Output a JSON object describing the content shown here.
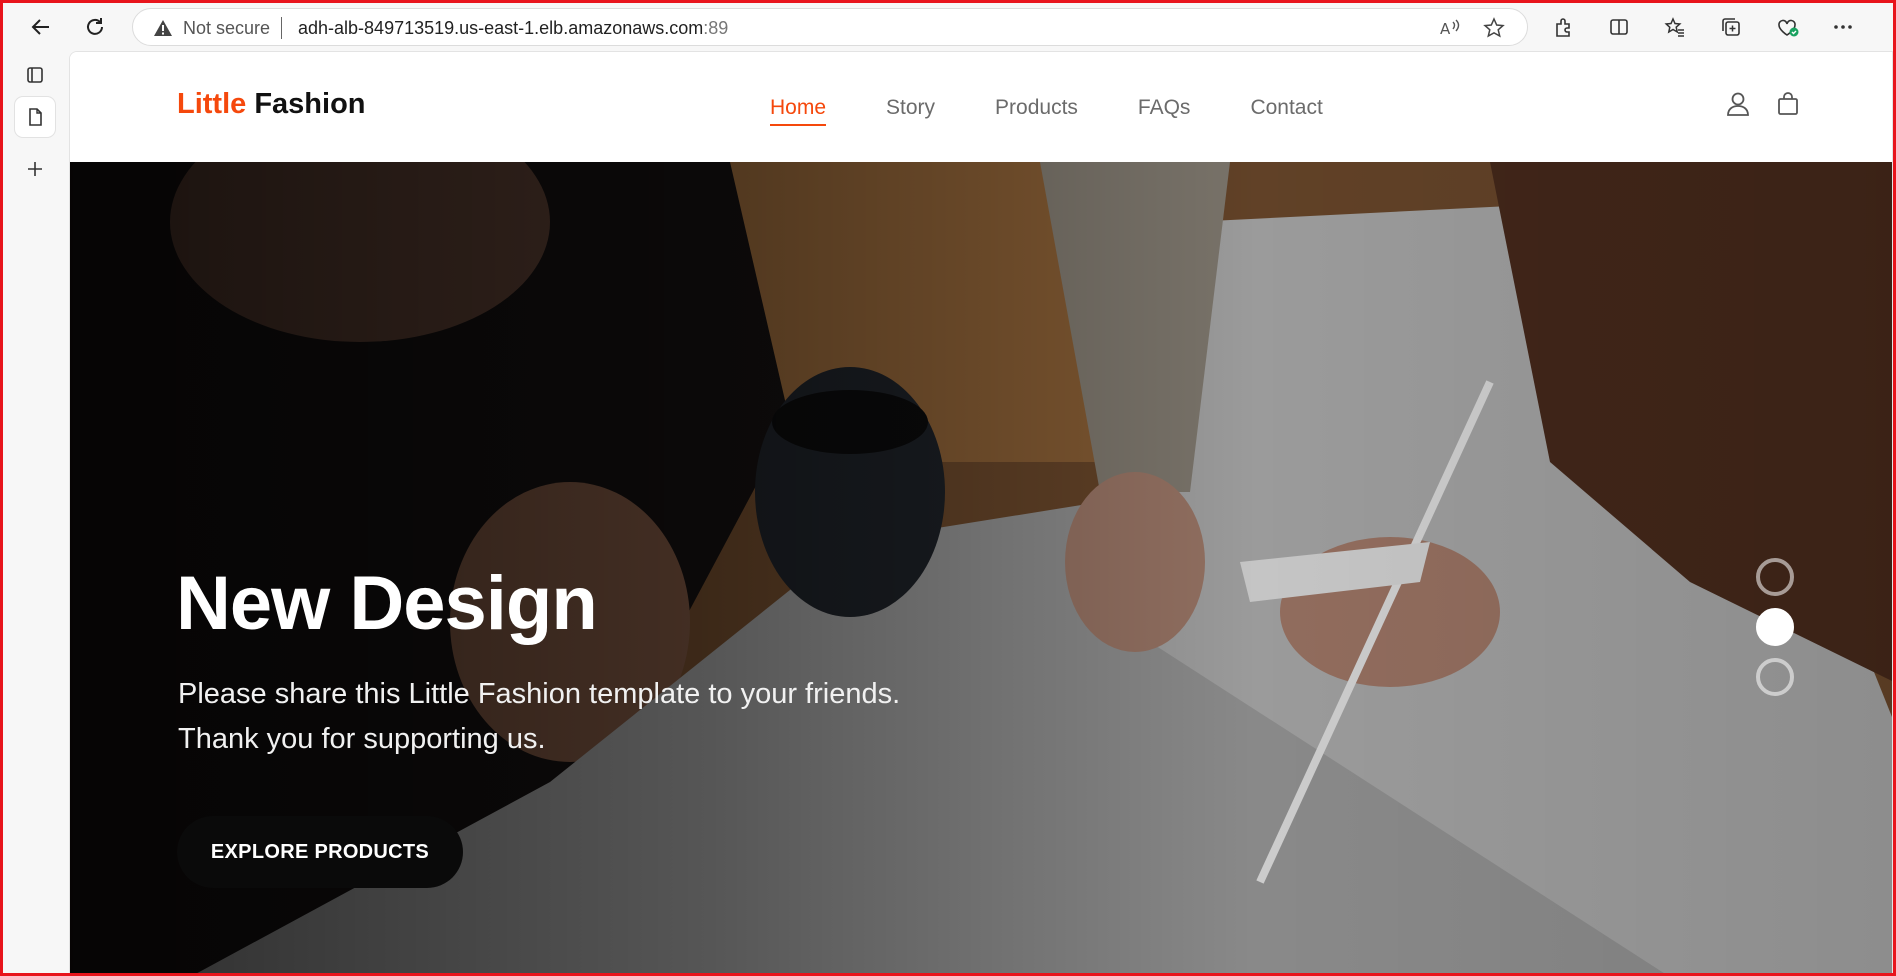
{
  "browser": {
    "security_label": "Not secure",
    "url_host": "adh-alb-849713519.us-east-1.elb.amazonaws.com",
    "url_port": ":89"
  },
  "site": {
    "logo_accent": "Little",
    "logo_main": " Fashion",
    "menu": [
      "Home",
      "Story",
      "Products",
      "FAQs",
      "Contact"
    ],
    "active_menu": "Home"
  },
  "hero": {
    "title": "New Design",
    "subtitle_line1": "Please share this Little Fashion template to your friends.",
    "subtitle_line2": "Thank you for supporting us.",
    "cta": "EXPLORE PRODUCTS",
    "slide_count": 3,
    "active_slide": 2
  },
  "colors": {
    "accent": "#f5480c",
    "frame_border": "#e8141c"
  }
}
